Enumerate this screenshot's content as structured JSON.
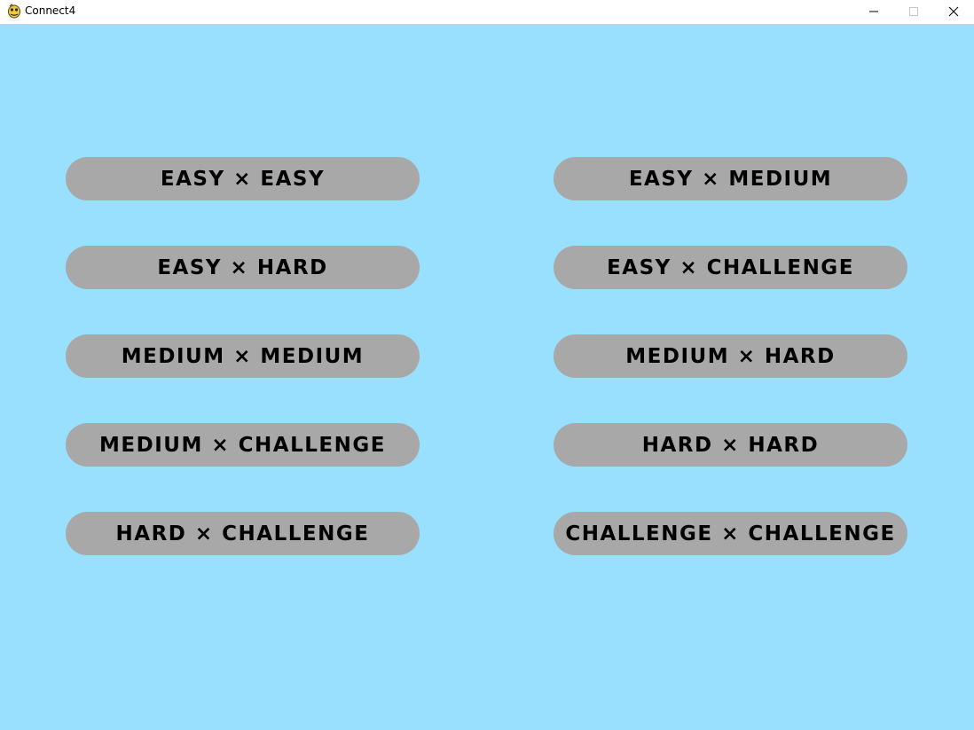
{
  "window": {
    "title": "Connect4",
    "icon": "pygame-snake-icon",
    "controls": {
      "minimize_icon": "minimize-icon",
      "maximize_icon": "maximize-icon",
      "close_icon": "close-icon"
    }
  },
  "colors": {
    "background": "#99dffe",
    "button": "#a8a8a8",
    "text": "#000000"
  },
  "menu": {
    "buttons": [
      {
        "label": "EASY × EASY"
      },
      {
        "label": "EASY × MEDIUM"
      },
      {
        "label": "EASY × HARD"
      },
      {
        "label": "EASY × CHALLENGE"
      },
      {
        "label": "MEDIUM × MEDIUM"
      },
      {
        "label": "MEDIUM × HARD"
      },
      {
        "label": "MEDIUM × CHALLENGE"
      },
      {
        "label": "HARD × HARD"
      },
      {
        "label": "HARD × CHALLENGE"
      },
      {
        "label": "CHALLENGE × CHALLENGE"
      }
    ]
  }
}
